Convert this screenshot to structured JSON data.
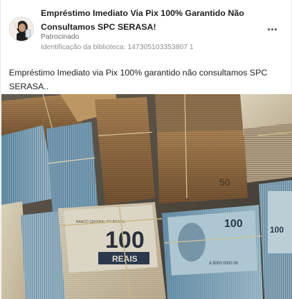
{
  "ad": {
    "title": "Empréstimo Imediato Via Pix 100% Garantido Não Consultamos SPC SERASA!",
    "sponsored_label": "Patrocinado",
    "library_id": "Identificação da biblioteca: 147305103353807 1",
    "body_text": "Empréstimo Imediato via Pix 100% garantido não consultamos SPC SERASA..",
    "more_icon": "more-horizontal-icon",
    "banknote_texts": {
      "bank_name": "BANCO CENTRAL DO BRASIL",
      "denomination": "100",
      "currency": "REAIS",
      "serial": "A 5000 0000 00",
      "fifty": "50"
    }
  }
}
